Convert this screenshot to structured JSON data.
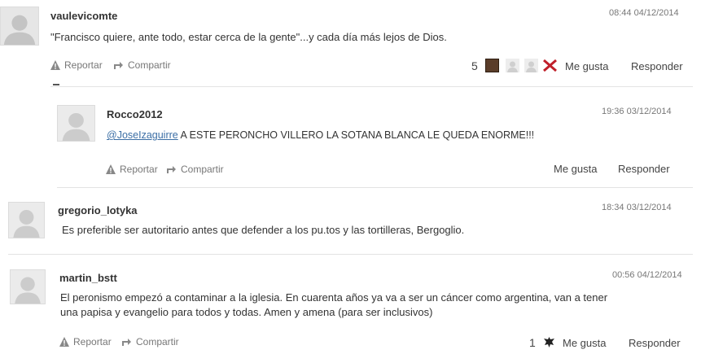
{
  "actions": {
    "report": "Reportar",
    "share": "Compartir",
    "like": "Me gusta",
    "reply": "Responder"
  },
  "comments": [
    {
      "author": "vaulevicomte",
      "timestamp": "08:44 04/12/2014",
      "text": "\"Francisco quiere, ante todo, estar cerca de la gente\"...y cada día más lejos de Dios.",
      "like_count": "5"
    },
    {
      "author": "Rocco2012",
      "timestamp": "19:36 03/12/2014",
      "mention": "@JoseIzaguirre",
      "text": " A ESTE PERONCHO VILLERO LA SOTANA BLANCA LE QUEDA ENORME!!!"
    },
    {
      "author": "gregorio_lotyka",
      "timestamp": "18:34 03/12/2014",
      "text": "Es preferible ser autoritario antes que defender a los pu.tos y las tortilleras, Bergoglio."
    },
    {
      "author": "martin_bstt",
      "timestamp": "00:56 04/12/2014",
      "text": "El peronismo empezó a contaminar a la iglesia. En cuarenta años ya va a ser un cáncer como argentina, van a tener una papisa y evangelio para todos y todas. Amen y amena (para ser inclusivos)",
      "like_count": "1"
    }
  ]
}
